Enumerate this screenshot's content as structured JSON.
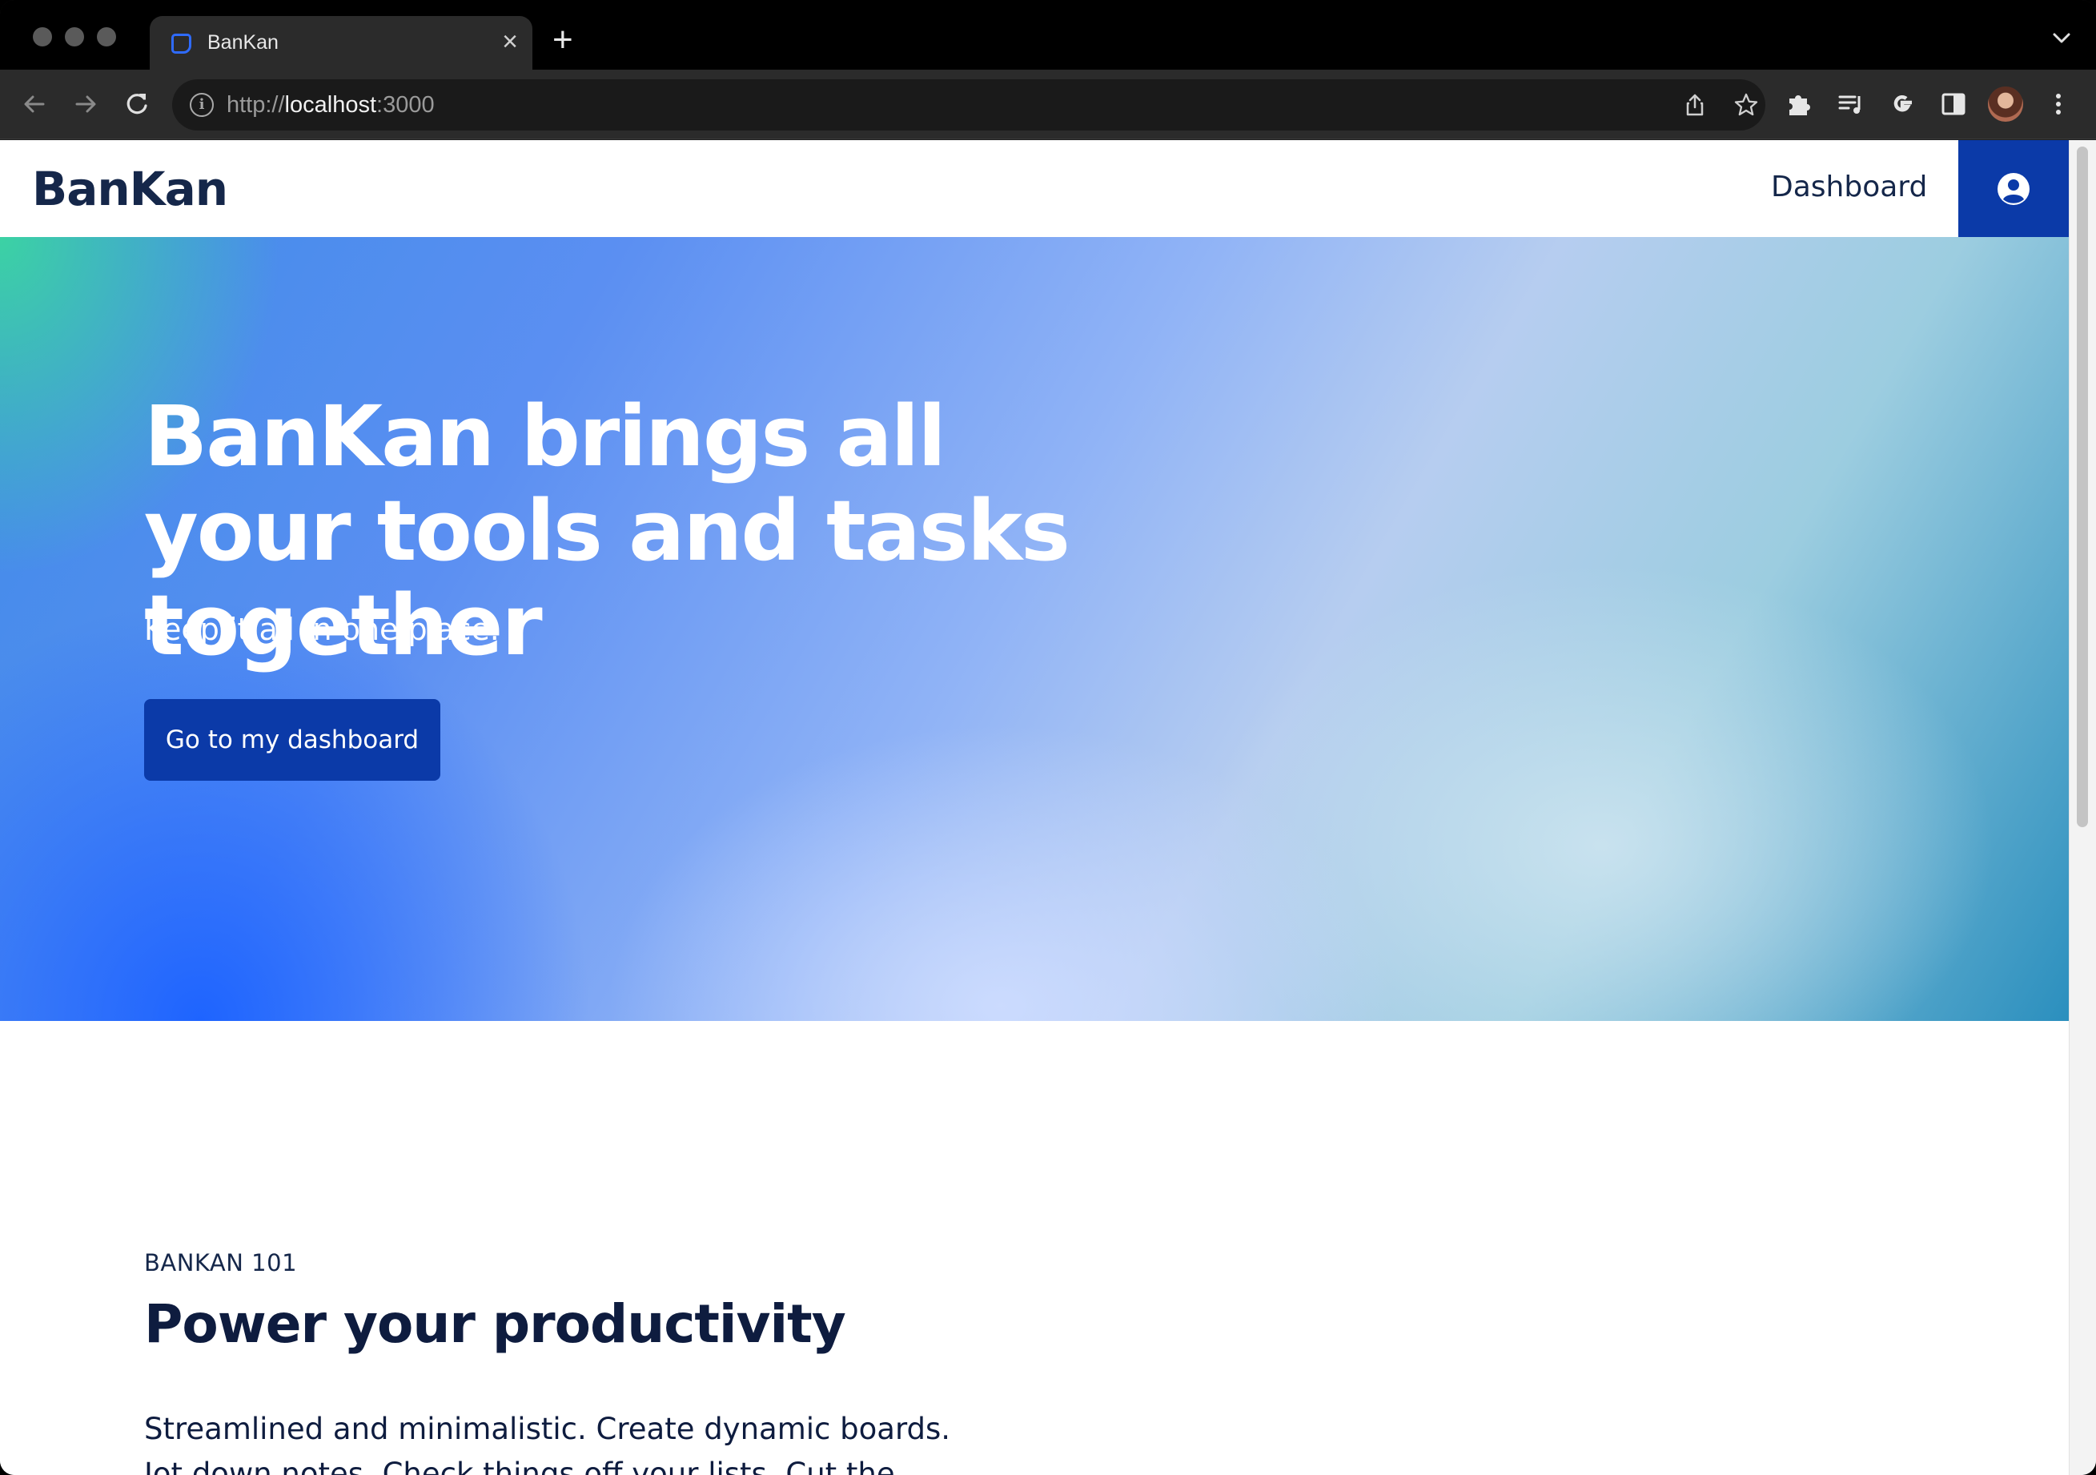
{
  "browser": {
    "tab_title": "BanKan",
    "tab_close": "×",
    "new_tab": "+",
    "url_scheme": "http://",
    "url_host": "localhost",
    "url_port": ":3000"
  },
  "site": {
    "logo": "BanKan",
    "nav_dashboard": "Dashboard"
  },
  "hero": {
    "title": "BanKan brings all your tools and tasks together",
    "subtitle": "Keep it all in one place.",
    "cta": "Go to my dashboard"
  },
  "section": {
    "eyebrow": "BANKAN 101",
    "title": "Power your productivity",
    "body": "Streamlined and minimalistic. Create dynamic boards. Jot down notes. Check things off your lists. Cut the clutter with just what you need. Start in seconds."
  },
  "colors": {
    "brand_dark": "#0b3aa8",
    "text_navy": "#15274a"
  }
}
